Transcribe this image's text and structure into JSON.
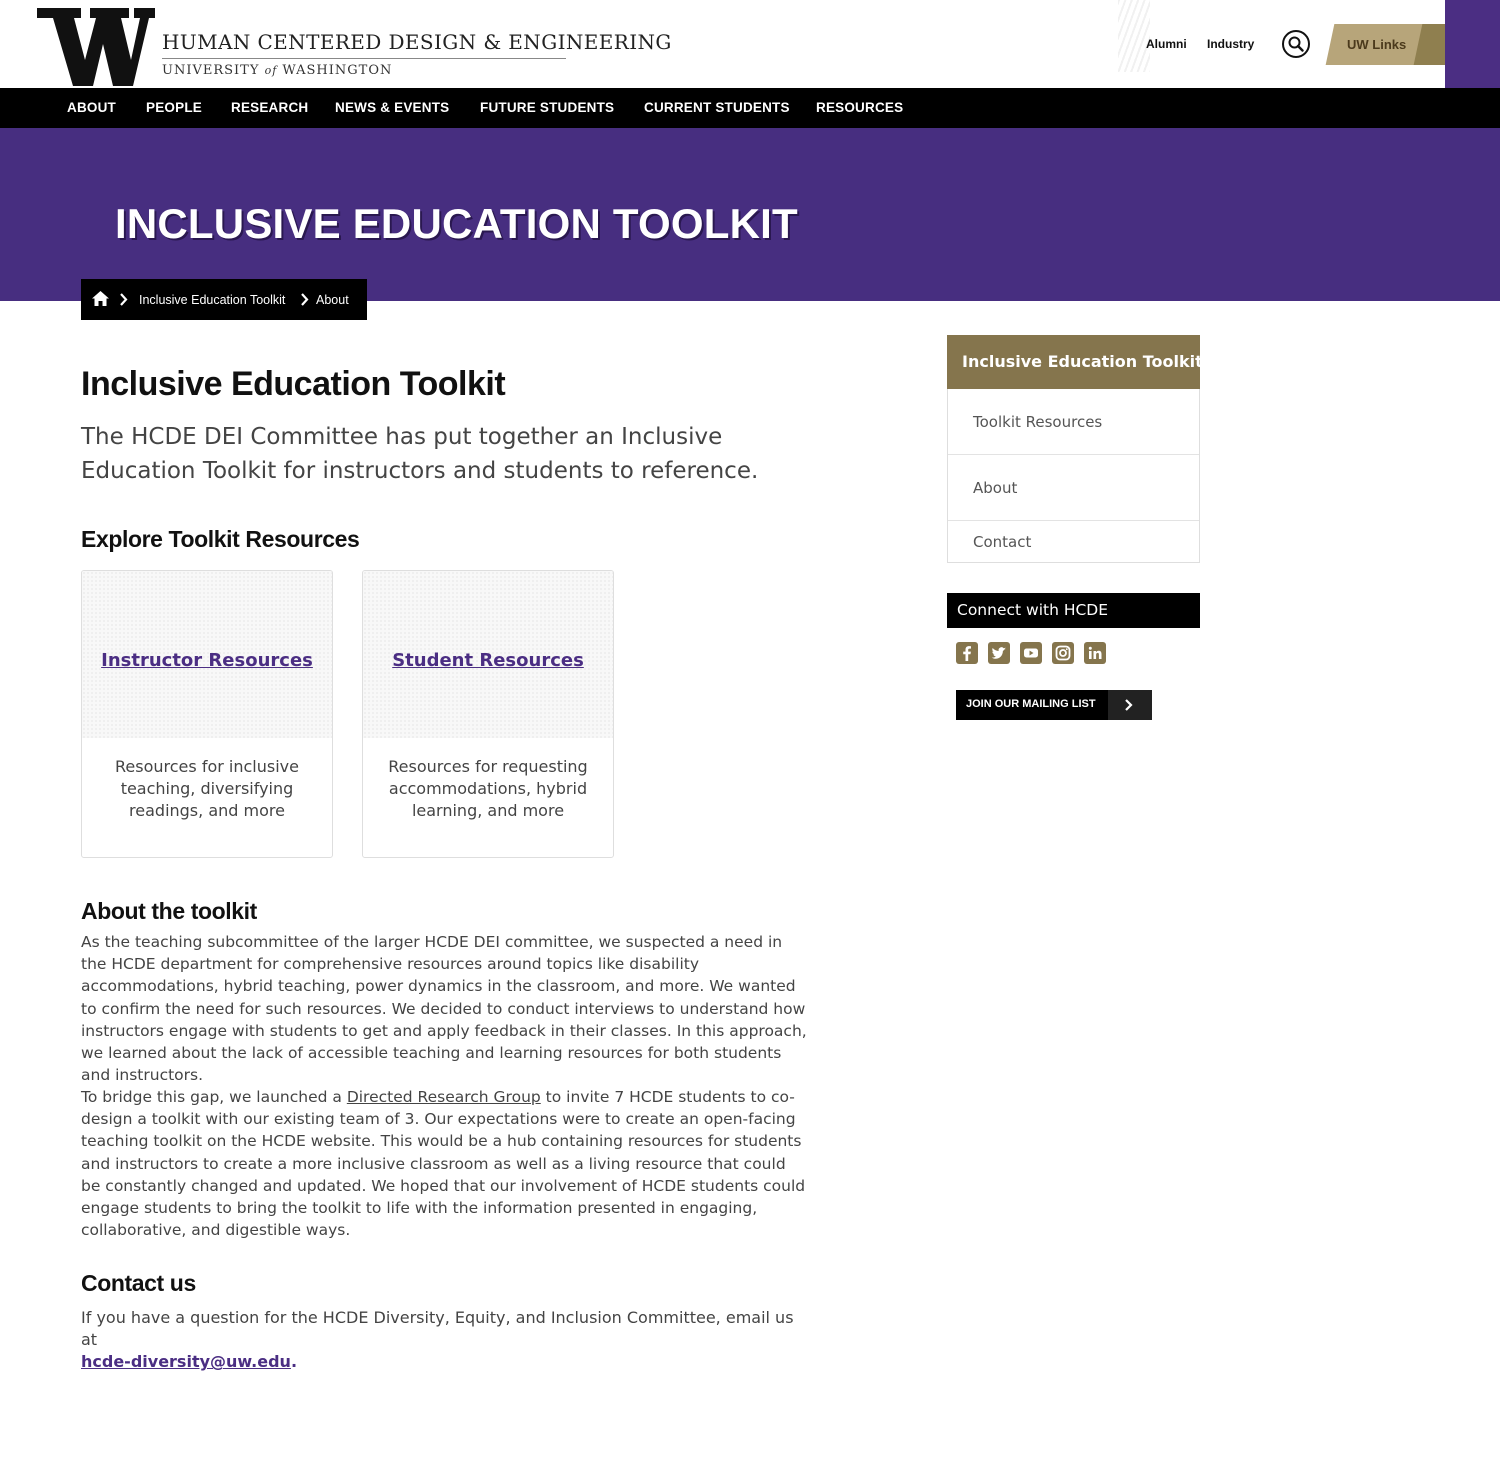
{
  "header": {
    "dept_name": "HUMAN CENTERED DESIGN & ENGINEERING",
    "univ_pre": "UNIVERSITY",
    "univ_of": "of",
    "univ_post": "WASHINGTON",
    "links": [
      "Alumni",
      "Industry"
    ],
    "uw_links": "UW Links"
  },
  "nav": [
    "ABOUT",
    "PEOPLE",
    "RESEARCH",
    "NEWS & EVENTS",
    "FUTURE STUDENTS",
    "CURRENT STUDENTS",
    "RESOURCES"
  ],
  "hero": {
    "title": "INCLUSIVE EDUCATION TOOLKIT"
  },
  "breadcrumb": [
    "Inclusive Education Toolkit",
    "About"
  ],
  "main": {
    "title": "Inclusive Education Toolkit",
    "lead": "The HCDE DEI Committee has put together an Inclusive Education Toolkit for instructors and students to reference.",
    "explore_heading": "Explore Toolkit Resources",
    "cards": [
      {
        "title": "Instructor Resources",
        "desc": "Resources for inclusive teaching, diversifying readings, and more"
      },
      {
        "title": "Student Resources",
        "desc": "Resources for requesting accommodations, hybrid learning, and more"
      }
    ],
    "about_heading": "About the toolkit",
    "about_p1": "As the teaching subcommittee of the larger HCDE DEI committee, we suspected a need in the HCDE department for comprehensive resources around topics like disability accommodations, hybrid teaching, power dynamics in the classroom, and more. We wanted to confirm the need for such resources. We decided to conduct interviews to understand how instructors engage with students to get and apply feedback in their classes. In this approach, we learned about the lack of accessible teaching and learning resources for both students and instructors.",
    "about_p2_pre": "To bridge this gap, we launched a ",
    "about_p2_link": "Directed Research Group",
    "about_p2_post": " to invite 7 HCDE students to co-design a toolkit with our existing team of 3. Our expectations were to create an open-facing teaching toolkit on the HCDE website. This would be a hub containing resources for students and instructors to create a more inclusive classroom as well as a living resource that could be constantly changed and updated. We hoped that our involvement of HCDE students could engage students to bring the toolkit to life with the information presented in engaging, collaborative, and digestible ways.",
    "contact_heading": "Contact us",
    "contact_text": "If you have a question for the HCDE Diversity, Equity, and Inclusion Committee, email us at",
    "contact_email": "hcde-diversity@uw.edu",
    "contact_period": "."
  },
  "sidebar": {
    "heading": "Inclusive Education Toolkit",
    "items": [
      "Toolkit Resources",
      "About",
      "Contact"
    ],
    "connect": "Connect with HCDE",
    "social_icons": [
      "facebook-icon",
      "twitter-icon",
      "youtube-icon",
      "instagram-icon",
      "linkedin-icon"
    ],
    "mailing": "JOIN OUR MAILING LIST"
  },
  "colors": {
    "purple": "#4b2e83",
    "gold": "#85754d",
    "uw_links_gold": "#b7a57a",
    "black": "#000000"
  }
}
